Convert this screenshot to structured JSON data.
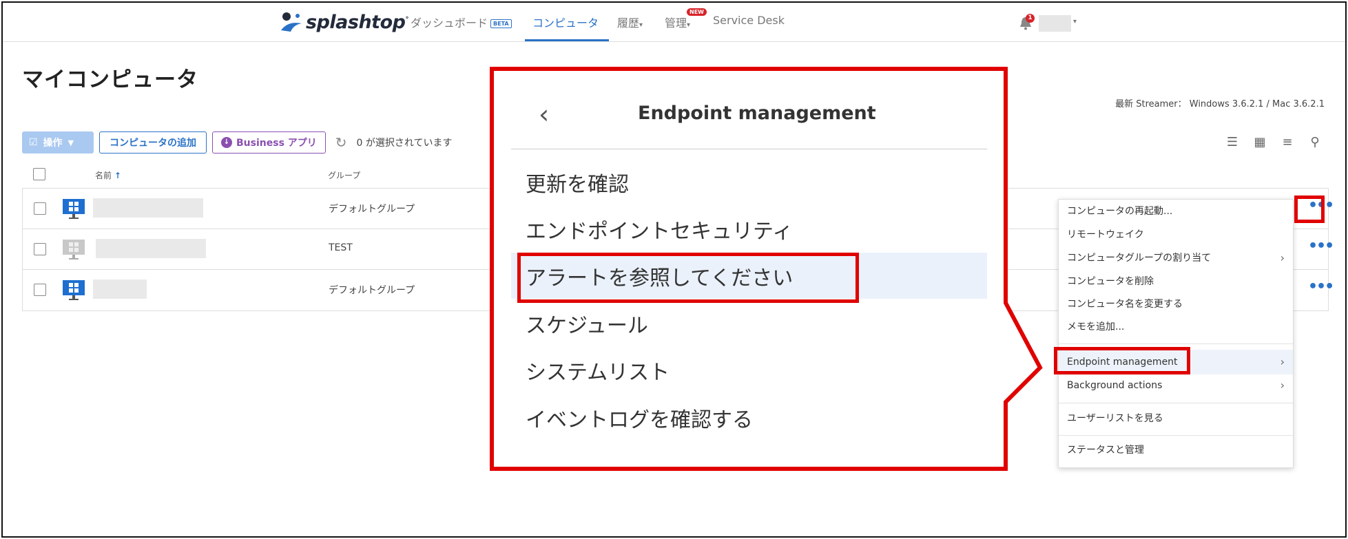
{
  "nav": {
    "logo_text": "splashtop",
    "dashboard": "ダッシュボード",
    "beta_badge": "BETA",
    "computers": "コンピュータ",
    "history": "履歴",
    "admin": "管理",
    "new_badge": "NEW",
    "service_desk": "Service Desk",
    "notification_count": "1"
  },
  "page": {
    "title": "マイコンピュータ",
    "streamer_info": "最新 Streamer： Windows 3.6.2.1 / Mac 3.6.2.1"
  },
  "toolbar": {
    "operations_label": "操作",
    "add_computer_label": "コンピュータの追加",
    "business_app_label": "Business アプリ",
    "selected_text": "0 が選択されています"
  },
  "table": {
    "header_name": "名前",
    "header_group": "グループ",
    "rows": [
      {
        "group": "デフォルトグループ"
      },
      {
        "group": "TEST"
      },
      {
        "group": "デフォルトグループ"
      }
    ]
  },
  "context_menu": {
    "items": [
      "コンピュータの再起動...",
      "リモートウェイク",
      "コンピュータグループの割り当て",
      "コンピュータを削除",
      "コンピュータ名を変更する",
      "メモを追加...",
      "Endpoint management",
      "Background actions",
      "ユーザーリストを見る",
      "ステータスと管理"
    ]
  },
  "submenu": {
    "title": "Endpoint management",
    "items": [
      "更新を確認",
      "エンドポイントセキュリティ",
      "アラートを参照してください",
      "スケジュール",
      "システムリスト",
      "イベントログを確認する"
    ]
  },
  "colors": {
    "accent": "#2a72c7",
    "annotation_red": "#e00000",
    "business_purple": "#8a4fb0"
  }
}
